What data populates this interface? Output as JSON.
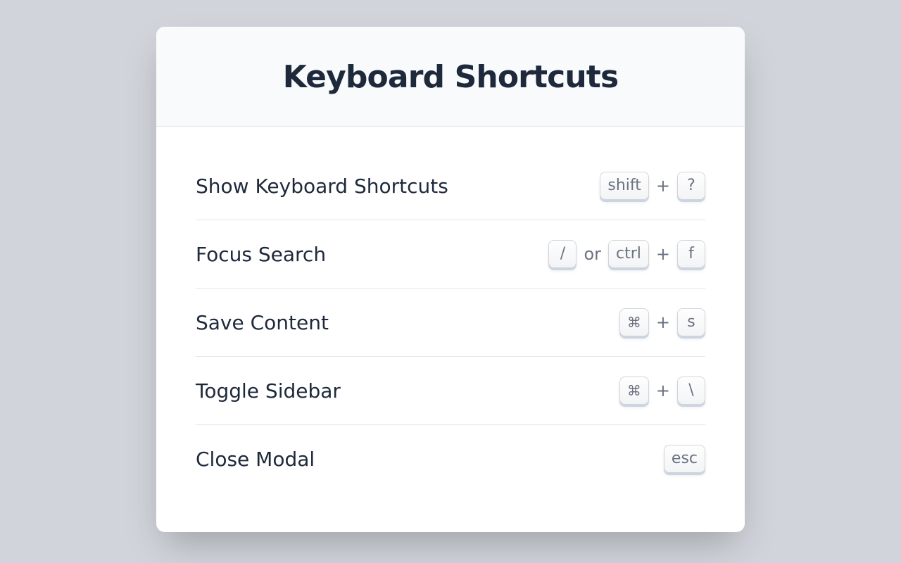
{
  "modal": {
    "title": "Keyboard Shortcuts",
    "separators": {
      "plus": "+",
      "or": "or"
    },
    "shortcuts": [
      {
        "label": "Show Keyboard Shortcuts",
        "keys": [
          {
            "type": "key",
            "value": "shift"
          },
          {
            "type": "sep",
            "value": "+"
          },
          {
            "type": "key",
            "value": "?"
          }
        ]
      },
      {
        "label": "Focus Search",
        "keys": [
          {
            "type": "key",
            "value": "/"
          },
          {
            "type": "sep",
            "value": "or"
          },
          {
            "type": "key",
            "value": "ctrl"
          },
          {
            "type": "sep",
            "value": "+"
          },
          {
            "type": "key",
            "value": "f"
          }
        ]
      },
      {
        "label": "Save Content",
        "keys": [
          {
            "type": "key",
            "value": "⌘"
          },
          {
            "type": "sep",
            "value": "+"
          },
          {
            "type": "key",
            "value": "s"
          }
        ]
      },
      {
        "label": "Toggle Sidebar",
        "keys": [
          {
            "type": "key",
            "value": "⌘"
          },
          {
            "type": "sep",
            "value": "+"
          },
          {
            "type": "key",
            "value": "\\"
          }
        ]
      },
      {
        "label": "Close Modal",
        "keys": [
          {
            "type": "key",
            "value": "esc"
          }
        ]
      }
    ]
  }
}
